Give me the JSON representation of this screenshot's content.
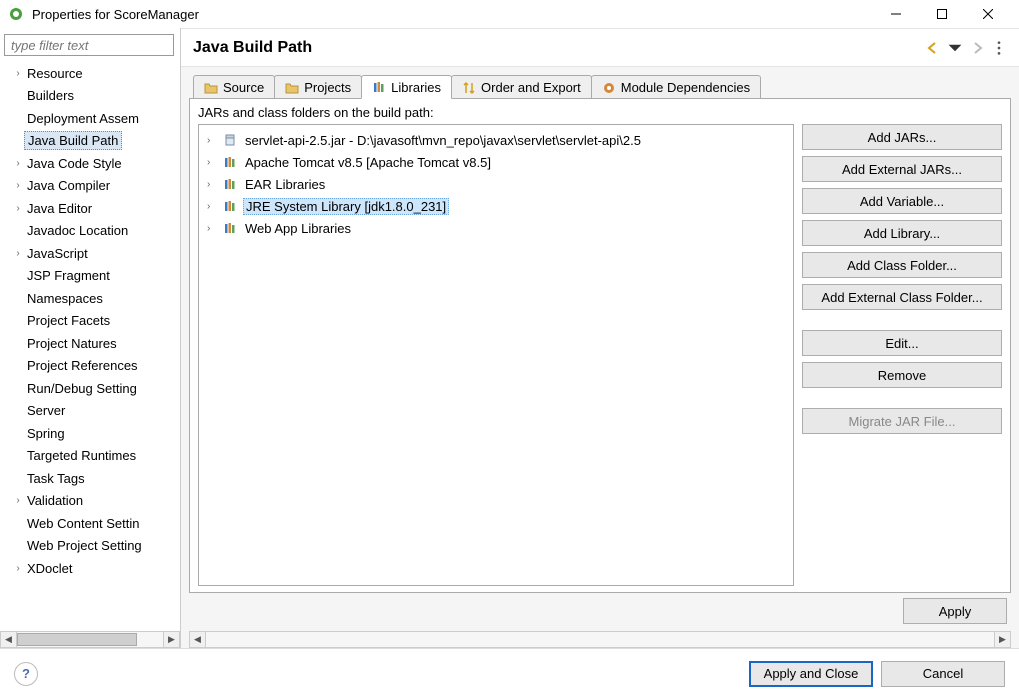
{
  "window": {
    "title": "Properties for ScoreManager"
  },
  "sidebar": {
    "filter_placeholder": "type filter text",
    "items": [
      {
        "label": "Resource",
        "expandable": true
      },
      {
        "label": "Builders",
        "expandable": false
      },
      {
        "label": "Deployment Assem",
        "expandable": false
      },
      {
        "label": "Java Build Path",
        "expandable": false,
        "selected": true
      },
      {
        "label": "Java Code Style",
        "expandable": true
      },
      {
        "label": "Java Compiler",
        "expandable": true
      },
      {
        "label": "Java Editor",
        "expandable": true
      },
      {
        "label": "Javadoc Location",
        "expandable": false
      },
      {
        "label": "JavaScript",
        "expandable": true
      },
      {
        "label": "JSP Fragment",
        "expandable": false
      },
      {
        "label": "Namespaces",
        "expandable": false
      },
      {
        "label": "Project Facets",
        "expandable": false
      },
      {
        "label": "Project Natures",
        "expandable": false
      },
      {
        "label": "Project References",
        "expandable": false
      },
      {
        "label": "Run/Debug Setting",
        "expandable": false
      },
      {
        "label": "Server",
        "expandable": false
      },
      {
        "label": "Spring",
        "expandable": false
      },
      {
        "label": "Targeted Runtimes",
        "expandable": false
      },
      {
        "label": "Task Tags",
        "expandable": false
      },
      {
        "label": "Validation",
        "expandable": true
      },
      {
        "label": "Web Content Settin",
        "expandable": false
      },
      {
        "label": "Web Project Setting",
        "expandable": false
      },
      {
        "label": "XDoclet",
        "expandable": true
      }
    ]
  },
  "content": {
    "heading": "Java Build Path",
    "tabs": {
      "source": "Source",
      "projects": "Projects",
      "libraries": "Libraries",
      "order": "Order and Export",
      "module": "Module Dependencies"
    },
    "desc": "JARs and class folders on the build path:",
    "jars": [
      {
        "label": "servlet-api-2.5.jar - D:\\javasoft\\mvn_repo\\javax\\servlet\\servlet-api\\2.5",
        "kind": "jar"
      },
      {
        "label": "Apache Tomcat v8.5 [Apache Tomcat v8.5]",
        "kind": "lib"
      },
      {
        "label": "EAR Libraries",
        "kind": "lib"
      },
      {
        "label": "JRE System Library [jdk1.8.0_231]",
        "kind": "lib",
        "selected": true
      },
      {
        "label": "Web App Libraries",
        "kind": "lib"
      }
    ],
    "buttons": {
      "add_jars": "Add JARs...",
      "add_ext_jars": "Add External JARs...",
      "add_variable": "Add Variable...",
      "add_library": "Add Library...",
      "add_class_folder": "Add Class Folder...",
      "add_ext_class_folder": "Add External Class Folder...",
      "edit": "Edit...",
      "remove": "Remove",
      "migrate": "Migrate JAR File..."
    },
    "apply": "Apply"
  },
  "footer": {
    "apply_close": "Apply and Close",
    "cancel": "Cancel"
  }
}
